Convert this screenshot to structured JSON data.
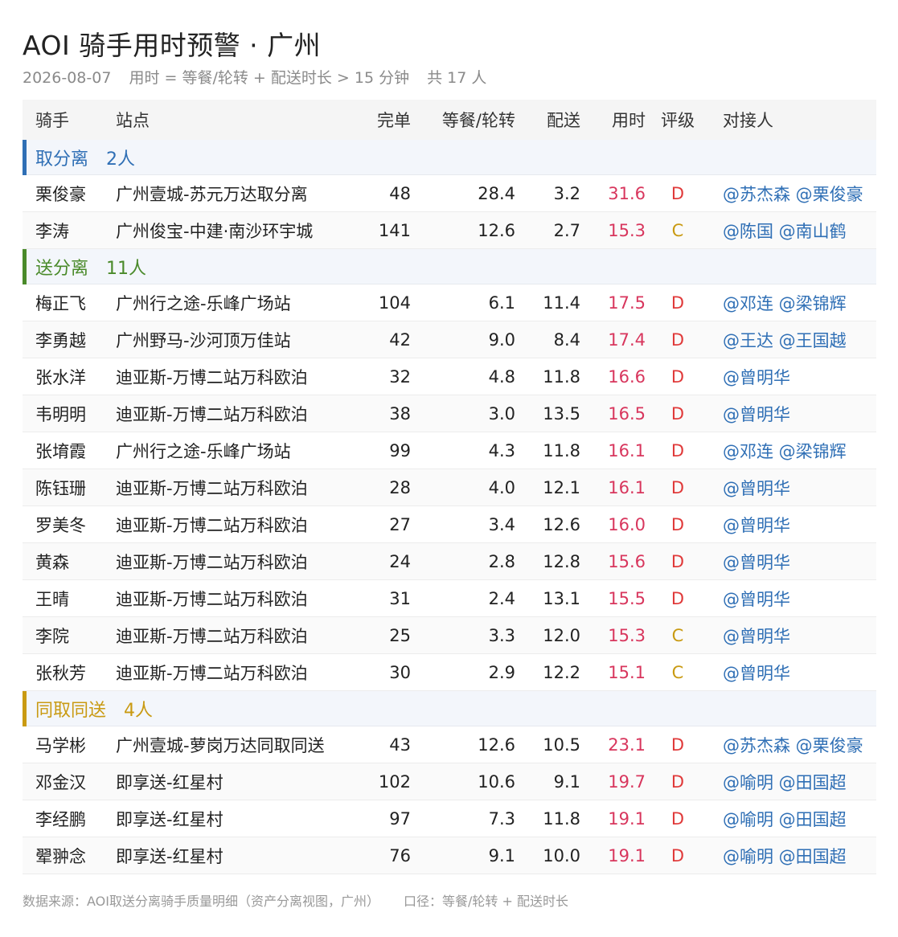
{
  "header": {
    "title": "AOI 骑手用时预警 · 广州",
    "date": "2026-08-07",
    "rule": "用时 = 等餐/轮转 + 配送时长 > 15 分钟",
    "total": "共 17 人"
  },
  "columns": [
    "骑手",
    "站点",
    "完单",
    "等餐/轮转",
    "配送",
    "用时",
    "评级",
    "对接人"
  ],
  "colors": {
    "group_1": "#2f6fb5",
    "group_2": "#4a8a2a",
    "group_3": "#c99a12",
    "time_red": "#d8365d",
    "grade_D": "#e03a3a",
    "grade_C": "#c99a12"
  },
  "groups": [
    {
      "name": "取分离",
      "count": "2人",
      "rows": [
        {
          "rider": "栗俊豪",
          "site": "广州壹城-苏元万达取分离",
          "done": "48",
          "wait": "28.4",
          "delivery": "3.2",
          "time": "31.6",
          "grade": "D",
          "contact": "@苏杰森 @栗俊豪"
        },
        {
          "rider": "李涛",
          "site": "广州俊宝-中建·南沙环宇城",
          "done": "141",
          "wait": "12.6",
          "delivery": "2.7",
          "time": "15.3",
          "grade": "C",
          "contact": "@陈国 @南山鹤"
        }
      ]
    },
    {
      "name": "送分离",
      "count": "11人",
      "rows": [
        {
          "rider": "梅正飞",
          "site": "广州行之途-乐峰广场站",
          "done": "104",
          "wait": "6.1",
          "delivery": "11.4",
          "time": "17.5",
          "grade": "D",
          "contact": "@邓连 @梁锦辉"
        },
        {
          "rider": "李勇越",
          "site": "广州野马-沙河顶万佳站",
          "done": "42",
          "wait": "9.0",
          "delivery": "8.4",
          "time": "17.4",
          "grade": "D",
          "contact": "@王达 @王国越"
        },
        {
          "rider": "张水洋",
          "site": "迪亚斯-万博二站万科欧泊",
          "done": "32",
          "wait": "4.8",
          "delivery": "11.8",
          "time": "16.6",
          "grade": "D",
          "contact": "@曾明华"
        },
        {
          "rider": "韦明明",
          "site": "迪亚斯-万博二站万科欧泊",
          "done": "38",
          "wait": "3.0",
          "delivery": "13.5",
          "time": "16.5",
          "grade": "D",
          "contact": "@曾明华"
        },
        {
          "rider": "张堉霞",
          "site": "广州行之途-乐峰广场站",
          "done": "99",
          "wait": "4.3",
          "delivery": "11.8",
          "time": "16.1",
          "grade": "D",
          "contact": "@邓连 @梁锦辉"
        },
        {
          "rider": "陈钰珊",
          "site": "迪亚斯-万博二站万科欧泊",
          "done": "28",
          "wait": "4.0",
          "delivery": "12.1",
          "time": "16.1",
          "grade": "D",
          "contact": "@曾明华"
        },
        {
          "rider": "罗美冬",
          "site": "迪亚斯-万博二站万科欧泊",
          "done": "27",
          "wait": "3.4",
          "delivery": "12.6",
          "time": "16.0",
          "grade": "D",
          "contact": "@曾明华"
        },
        {
          "rider": "黄森",
          "site": "迪亚斯-万博二站万科欧泊",
          "done": "24",
          "wait": "2.8",
          "delivery": "12.8",
          "time": "15.6",
          "grade": "D",
          "contact": "@曾明华"
        },
        {
          "rider": "王晴",
          "site": "迪亚斯-万博二站万科欧泊",
          "done": "31",
          "wait": "2.4",
          "delivery": "13.1",
          "time": "15.5",
          "grade": "D",
          "contact": "@曾明华"
        },
        {
          "rider": "李院",
          "site": "迪亚斯-万博二站万科欧泊",
          "done": "25",
          "wait": "3.3",
          "delivery": "12.0",
          "time": "15.3",
          "grade": "C",
          "contact": "@曾明华"
        },
        {
          "rider": "张秋芳",
          "site": "迪亚斯-万博二站万科欧泊",
          "done": "30",
          "wait": "2.9",
          "delivery": "12.2",
          "time": "15.1",
          "grade": "C",
          "contact": "@曾明华"
        }
      ]
    },
    {
      "name": "同取同送",
      "count": "4人",
      "rows": [
        {
          "rider": "马学彬",
          "site": "广州壹城-萝岗万达同取同送",
          "done": "43",
          "wait": "12.6",
          "delivery": "10.5",
          "time": "23.1",
          "grade": "D",
          "contact": "@苏杰森 @栗俊豪"
        },
        {
          "rider": "邓金汉",
          "site": "即享送-红星村",
          "done": "102",
          "wait": "10.6",
          "delivery": "9.1",
          "time": "19.7",
          "grade": "D",
          "contact": "@喻明 @田国超"
        },
        {
          "rider": "李经鹏",
          "site": "即享送-红星村",
          "done": "97",
          "wait": "7.3",
          "delivery": "11.8",
          "time": "19.1",
          "grade": "D",
          "contact": "@喻明 @田国超"
        },
        {
          "rider": "翚翀念",
          "site": "即享送-红星村",
          "done": "76",
          "wait": "9.1",
          "delivery": "10.0",
          "time": "19.1",
          "grade": "D",
          "contact": "@喻明 @田国超"
        }
      ]
    }
  ],
  "footer": {
    "source": "数据来源：AOI取送分离骑手质量明细（资产分离视图，广州）",
    "basis": "口径：等餐/轮转 + 配送时长"
  }
}
